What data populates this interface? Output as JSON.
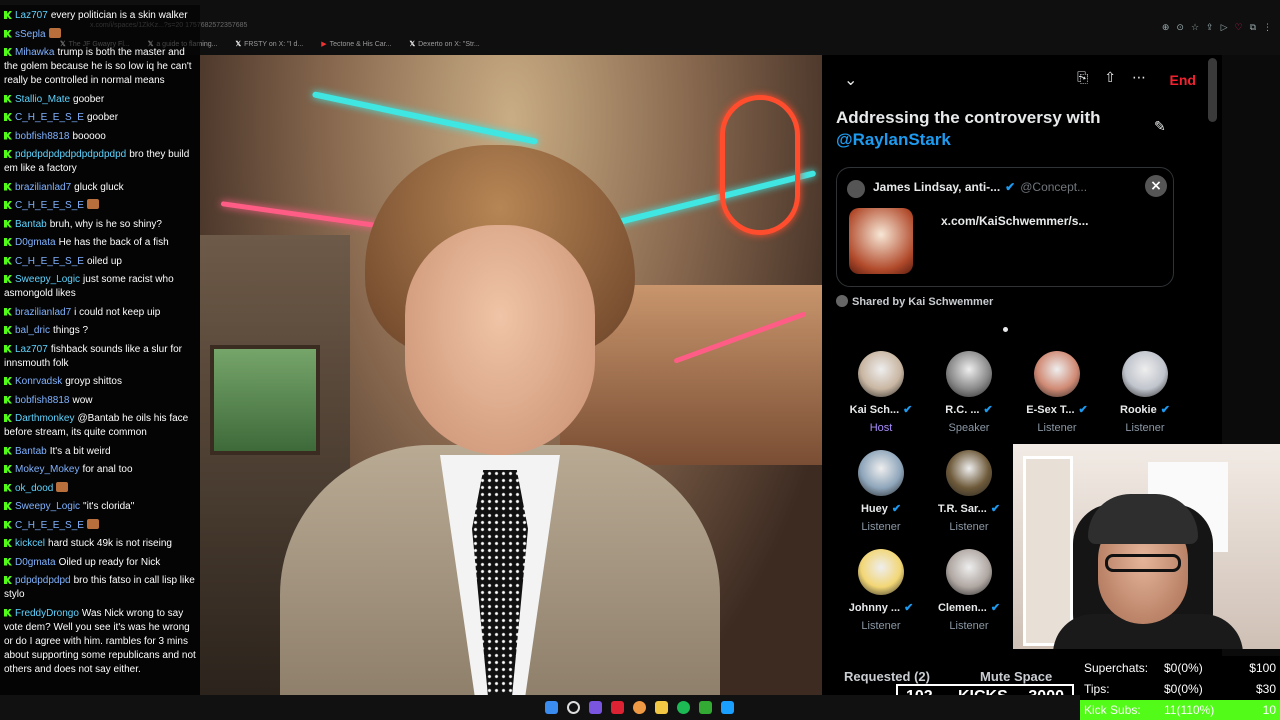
{
  "browser": {
    "url": "x.com/i/spaces/1ZkKz...?s=20 1757682572357685",
    "tabs": [
      {
        "icon": "x",
        "label": "The JF Gwayry Fl..."
      },
      {
        "icon": "x",
        "label": "a guide to flaming..."
      },
      {
        "icon": "x",
        "label": "FRSTY on X: \"I d..."
      },
      {
        "icon": "yt",
        "label": "Tectone & His Car..."
      },
      {
        "icon": "x",
        "label": "Dexerto on X: \"Str..."
      }
    ]
  },
  "chat": {
    "messages": [
      {
        "user": "Laz707",
        "text": "every politician is a skin walker"
      },
      {
        "user": "sSepla",
        "text": ""
      },
      {
        "user": "Mihawka",
        "text": "trump is both the master and the golem because he is so low iq he can't really be controlled in normal means"
      },
      {
        "user": "Stallio_Mate",
        "text": "goober"
      },
      {
        "user": "C_H_E_E_S_E",
        "text": "goober"
      },
      {
        "user": "bobfish8818",
        "text": "booooo"
      },
      {
        "user": "pdpdpdpdpdpdpdpdpdpd",
        "text": "bro they build em like a factory"
      },
      {
        "user": "brazilianlad7",
        "text": "gluck gluck"
      },
      {
        "user": "C_H_E_E_S_E",
        "text": ""
      },
      {
        "user": "Bantab",
        "text": "bruh, why is he so shiny?"
      },
      {
        "user": "D0gmata",
        "text": "He has the back of a fish"
      },
      {
        "user": "C_H_E_E_S_E",
        "text": "oiled up"
      },
      {
        "user": "Sweepy_Logic",
        "text": "just some racist who asmongold likes"
      },
      {
        "user": "brazilianlad7",
        "text": "i could not keep uip"
      },
      {
        "user": "bal_dric",
        "text": "things ?"
      },
      {
        "user": "Laz707",
        "text": "fishback sounds like a slur for innsmouth folk"
      },
      {
        "user": "Konrvadsk",
        "text": "groyp shittos"
      },
      {
        "user": "bobfish8818",
        "text": "wow"
      },
      {
        "user": "Darthmonkey",
        "text": "@Bantab he oils his face before stream, its quite common"
      },
      {
        "user": "Bantab",
        "text": "It's a bit weird"
      },
      {
        "user": "Mokey_Mokey",
        "text": "for anal too"
      },
      {
        "user": "ok_dood",
        "text": ""
      },
      {
        "user": "Sweepy_Logic",
        "text": "\"it's clorida\""
      },
      {
        "user": "C_H_E_E_S_E",
        "text": ""
      },
      {
        "user": "kickcel",
        "text": "hard stuck 49k is not riseing"
      },
      {
        "user": "D0gmata",
        "text": "Oiled up ready for Nick"
      },
      {
        "user": "pdpdpdpdpd",
        "text": "bro this fatso in call lisp like stylo"
      },
      {
        "user": "FreddyDrongo",
        "text": "Was Nick wrong to say vote dem? Well you see it's was he wrong or do I agree with him. rambles for 3 mins about supporting some republicans and not others and does not say either."
      }
    ]
  },
  "space": {
    "end_label": "End",
    "title": "Addressing the controversy with",
    "host_handle": "@RaylanStark",
    "card": {
      "author": "James Lindsay, anti-...",
      "handle": "@Concept...",
      "link": "x.com/KaiSchwemmer/s..."
    },
    "shared_by": "Shared by Kai Schwemmer",
    "participants": [
      {
        "name": "Kai Sch...",
        "role": "Host",
        "verified": true,
        "color": "#c9b6a2"
      },
      {
        "name": "R.C. ...",
        "role": "Speaker",
        "verified": true,
        "color": "#8a8a8a"
      },
      {
        "name": "E-Sex T...",
        "role": "Listener",
        "verified": true,
        "color": "#d08a74"
      },
      {
        "name": "Rookie",
        "role": "Listener",
        "verified": true,
        "color": "#c0c4cc"
      },
      {
        "name": "Huey",
        "role": "Listener",
        "verified": true,
        "color": "#8fa6bb"
      },
      {
        "name": "T.R. Sar...",
        "role": "Listener",
        "verified": true,
        "color": "#6e5a3a"
      },
      {
        "name": "Johnny ...",
        "role": "Listener",
        "verified": true,
        "color": "#f2d675"
      },
      {
        "name": "Clemen...",
        "role": "Listener",
        "verified": true,
        "color": "#b0a7a2"
      }
    ],
    "requested_label": "Requested (2)",
    "mute_label": "Mute Space"
  },
  "goals": {
    "rows": [
      {
        "label": "Superchats:",
        "value": "$0(0%)",
        "max": "$100"
      },
      {
        "label": "Tips:",
        "value": "$0(0%)",
        "max": "$30"
      },
      {
        "label": "Kick Subs:",
        "value": "11(110%)",
        "max": "10",
        "fill": 1.0
      }
    ]
  },
  "kicks": {
    "current": "102",
    "label": "KICKS",
    "goal": "3000"
  },
  "colors": {
    "kick_green": "#53fc18",
    "x_blue": "#1d9bf0",
    "end_red": "#f4212e"
  }
}
